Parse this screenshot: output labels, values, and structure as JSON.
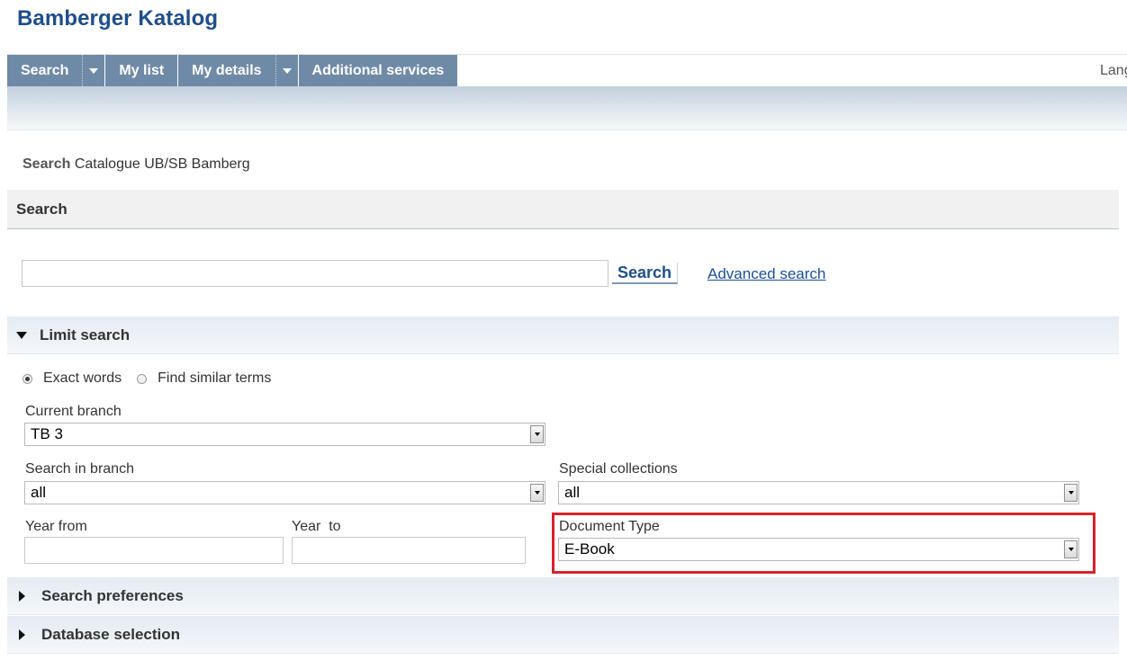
{
  "app_title": "Bamberger Katalog",
  "nav": {
    "items": [
      {
        "label": "Search",
        "dropdown": true
      },
      {
        "label": "My list",
        "dropdown": false
      },
      {
        "label": "My details",
        "dropdown": true
      },
      {
        "label": "Additional services",
        "dropdown": false
      }
    ],
    "language_label": "Lang"
  },
  "breadcrumb": {
    "bold": "Search",
    "rest": "Catalogue UB/SB Bamberg"
  },
  "search_section": {
    "heading": "Search",
    "input_value": "",
    "button_label": "Search",
    "advanced_link": "Advanced search"
  },
  "limit": {
    "heading": "Limit search",
    "radios": [
      {
        "label": "Exact words",
        "checked": true
      },
      {
        "label": "Find similar terms",
        "checked": false
      }
    ],
    "current_branch": {
      "label": "Current branch",
      "value": "TB 3"
    },
    "search_in_branch": {
      "label": "Search in branch",
      "value": "all"
    },
    "special_collections": {
      "label": "Special collections",
      "value": "all"
    },
    "year_from": {
      "label": "Year from",
      "value": ""
    },
    "year_to": {
      "label": "Year  to",
      "value": ""
    },
    "document_type": {
      "label": "Document Type",
      "value": "E-Book"
    }
  },
  "search_preferences": {
    "heading": "Search preferences"
  },
  "database_selection": {
    "heading": "Database selection"
  },
  "colors": {
    "brand": "#1f4e8c",
    "nav_bg": "#6f8aa7",
    "highlight": "#d8222c",
    "link": "#1a4f9c"
  }
}
